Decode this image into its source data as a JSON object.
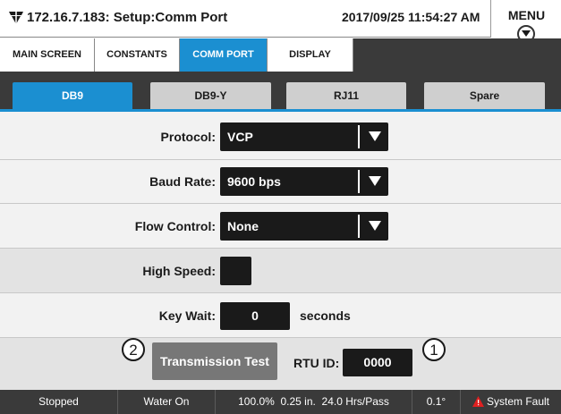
{
  "titlebar": {
    "title": "172.16.7.183: Setup:Comm Port",
    "datetime": "2017/09/25 11:54:27 AM",
    "menu_label": "MENU"
  },
  "top_tabs": [
    {
      "label": "MAIN SCREEN",
      "active": false
    },
    {
      "label": "CONSTANTS",
      "active": false
    },
    {
      "label": "COMM PORT",
      "active": true
    },
    {
      "label": "DISPLAY",
      "active": false
    }
  ],
  "port_tabs": [
    {
      "label": "DB9",
      "active": true
    },
    {
      "label": "DB9-Y",
      "active": false
    },
    {
      "label": "RJ11",
      "active": false
    },
    {
      "label": "Spare",
      "active": false
    }
  ],
  "form": {
    "protocol": {
      "label": "Protocol:",
      "value": "VCP"
    },
    "baud_rate": {
      "label": "Baud Rate:",
      "value": "9600 bps"
    },
    "flow_control": {
      "label": "Flow Control:",
      "value": "None"
    },
    "high_speed": {
      "label": "High Speed:",
      "checked": false
    },
    "key_wait": {
      "label": "Key Wait:",
      "value": "0",
      "unit": "seconds"
    },
    "transmission_test_label": "Transmission Test",
    "rtu_id": {
      "label": "RTU ID:",
      "value": "0000"
    },
    "callouts": [
      "2",
      "1"
    ]
  },
  "status_bar": {
    "state": "Stopped",
    "water": "Water On",
    "percent": "100.0%",
    "depth": "0.25 in.",
    "pass_time": "24.0 Hrs/Pass",
    "angle": "0.1°",
    "fault": "System Fault"
  },
  "colors": {
    "accent": "#1b8fd1",
    "dark": "#3a3a3a",
    "fault": "#e02020"
  }
}
